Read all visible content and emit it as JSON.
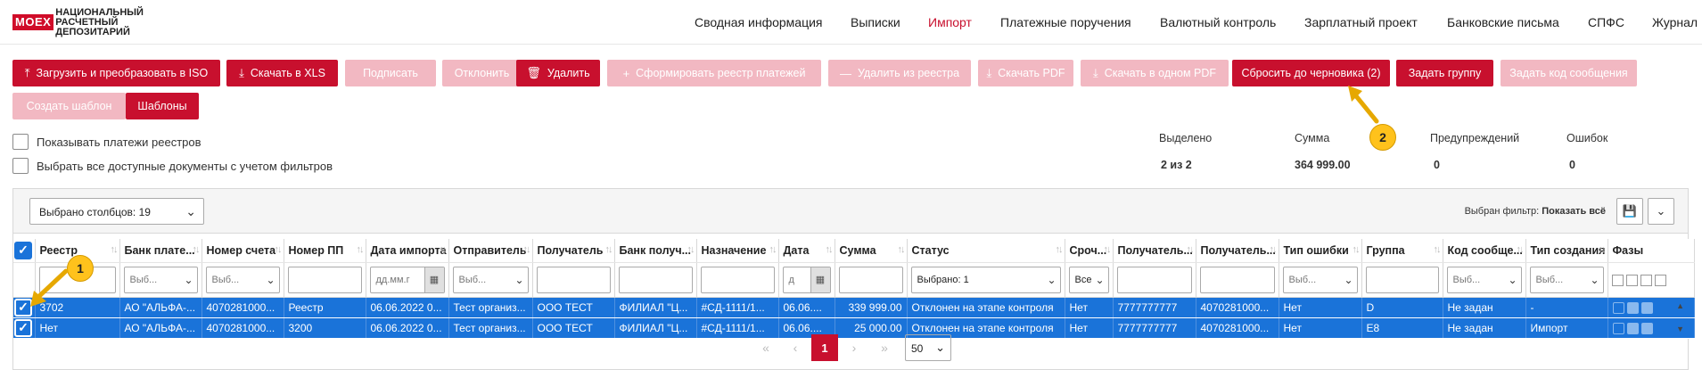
{
  "logo": {
    "box": "MOEX",
    "lines": [
      "Национальный",
      "расчетный",
      "депозитарий"
    ]
  },
  "nav": [
    {
      "label": "Сводная информация",
      "active": false
    },
    {
      "label": "Выписки",
      "active": false
    },
    {
      "label": "Импорт",
      "active": true
    },
    {
      "label": "Платежные поручения",
      "active": false
    },
    {
      "label": "Валютный контроль",
      "active": false
    },
    {
      "label": "Зарплатный проект",
      "active": false
    },
    {
      "label": "Банковские письма",
      "active": false
    },
    {
      "label": "СПФС",
      "active": false
    },
    {
      "label": "Журнал",
      "active": false
    }
  ],
  "toolbar": {
    "upload_iso": "Загрузить и преобразовать в ISO",
    "download_xls": "Скачать в XLS",
    "sign": "Подписать",
    "reject": "Отклонить",
    "delete": "Удалить",
    "form_registry": "Сформировать реестр платежей",
    "remove_registry": "Удалить из реестра",
    "download_pdf": "Скачать PDF",
    "download_one_pdf": "Скачать в одном PDF",
    "reset_draft": "Сбросить до черновика (2)",
    "set_group": "Задать группу",
    "set_msg_code": "Задать код сообщения",
    "create_template": "Создать шаблон",
    "templates": "Шаблоны"
  },
  "options": {
    "show_registry_payments": "Показывать платежи реестров",
    "select_all_filtered": "Выбрать все доступные документы с учетом фильтров"
  },
  "summary": {
    "selected_label": "Выделено",
    "selected_value": "2 из 2",
    "sum_label": "Сумма",
    "sum_value": "364 999.00",
    "warnings_label": "Предупреждений",
    "warnings_value": "0",
    "errors_label": "Ошибок",
    "errors_value": "0"
  },
  "grid": {
    "columns_selected": "Выбрано столбцов: 19",
    "filter_prefix": "Выбран фильтр:",
    "filter_value": "Показать всё",
    "headers": [
      "Реестр",
      "Банк плате...",
      "Номер счета",
      "Номер ПП",
      "Дата импорта",
      "Отправитель",
      "Получатель",
      "Банк получ...",
      "Назначение",
      "Дата",
      "Сумма",
      "Статус",
      "Сроч...",
      "Получатель...",
      "Получатель...",
      "Тип ошибки",
      "Группа",
      "Код сообще...",
      "Тип создания",
      "Фазы"
    ],
    "filters": {
      "bank_payer": "Выб...",
      "account": "Выб...",
      "import_date": "дд.мм.г",
      "sender": "Выб...",
      "date": "д",
      "status": "Выбрано: 1",
      "urgent": "Все",
      "error_type": "Выб...",
      "msg_code": "Выб...",
      "creation_type": "Выб..."
    },
    "rows": [
      [
        "3702",
        "АО \"АЛЬФА-...",
        "4070281000...",
        "Реестр",
        "06.06.2022 0...",
        "Тест организ...",
        "ООО ТЕСТ",
        "ФИЛИАЛ \"Ц...",
        "#СД-1111/1...",
        "06.06....",
        "339 999.00",
        "Отклонен на этапе контроля",
        "Нет",
        "7777777777",
        "4070281000...",
        "Нет",
        "D",
        "Не задан",
        "-"
      ],
      [
        "Нет",
        "АО \"АЛЬФА-...",
        "4070281000...",
        "3200",
        "06.06.2022 0...",
        "Тест организ...",
        "ООО ТЕСТ",
        "ФИЛИАЛ \"Ц...",
        "#СД-1111/1...",
        "06.06....",
        "25 000.00",
        "Отклонен на этапе контроля",
        "Нет",
        "7777777777",
        "4070281000...",
        "Нет",
        "E8",
        "Не задан",
        "Импорт"
      ]
    ]
  },
  "pager": {
    "current": "1",
    "page_size": "50"
  },
  "annotations": {
    "badge1": "1",
    "badge2": "2"
  },
  "colors": {
    "brand": "#c8102e",
    "selection": "#1a73d9",
    "annotation": "#ffc21c"
  }
}
